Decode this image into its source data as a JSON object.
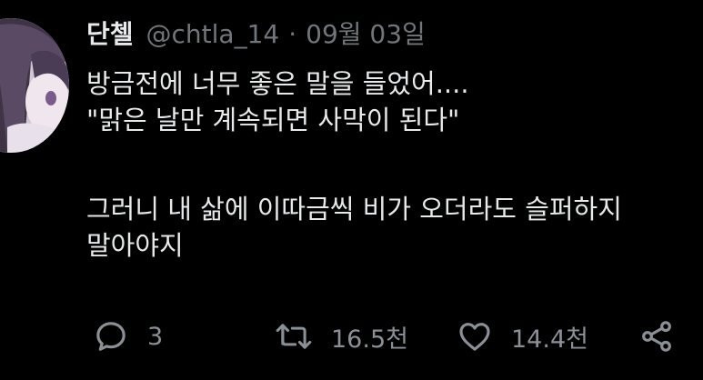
{
  "author": {
    "display_name": "단첼",
    "handle": "@chtla_14",
    "separator": "·",
    "date": "09월 03일"
  },
  "tweet": {
    "lines": [
      "방금전에 너무 좋은 말을 들었어....",
      "\"맑은 날만 계속되면 사막이 된다\"",
      "그러니 내 삶에 이따금씩 비가 오더라도 슬퍼하지",
      "말아야지"
    ]
  },
  "actions": {
    "reply_count": "3",
    "retweet_count": "16.5천",
    "like_count": "14.4천"
  },
  "icons": {
    "reply": "reply-icon",
    "retweet": "retweet-icon",
    "like": "heart-icon",
    "share": "share-icon"
  },
  "colors": {
    "background": "#000000",
    "text": "#e7e9ea",
    "secondary": "#71767b",
    "action": "#8b9097"
  }
}
